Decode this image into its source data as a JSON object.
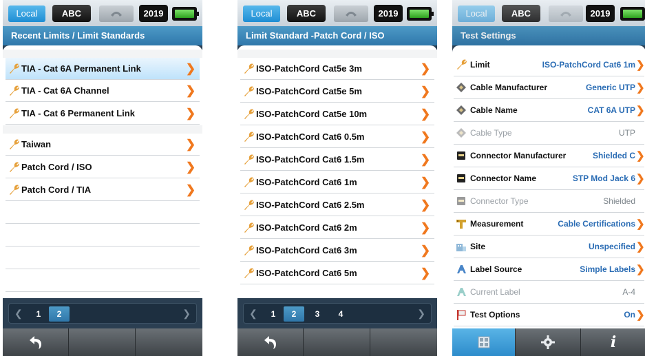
{
  "status": {
    "local_label": "Local",
    "abc_label": "ABC",
    "year_label": "2019"
  },
  "screen1": {
    "title": "Recent Limits / Limit Standards",
    "items": [
      {
        "label": "TIA - Cat 6A Permanent Link"
      },
      {
        "label": "TIA - Cat 6A Channel"
      },
      {
        "label": "TIA - Cat 6 Permanent Link"
      },
      {
        "label": "Taiwan"
      },
      {
        "label": "Patch Cord / ISO"
      },
      {
        "label": "Patch Cord / TIA"
      }
    ],
    "pages": [
      "1",
      "2"
    ],
    "active_page": "2"
  },
  "screen2": {
    "title": "Limit Standard -Patch Cord / ISO",
    "items": [
      {
        "label": "ISO-PatchCord Cat5e 3m"
      },
      {
        "label": "ISO-PatchCord Cat5e 5m"
      },
      {
        "label": "ISO-PatchCord Cat5e 10m"
      },
      {
        "label": "ISO-PatchCord Cat6 0.5m"
      },
      {
        "label": "ISO-PatchCord Cat6 1.5m"
      },
      {
        "label": "ISO-PatchCord Cat6 1m"
      },
      {
        "label": "ISO-PatchCord Cat6 2.5m"
      },
      {
        "label": "ISO-PatchCord Cat6 2m"
      },
      {
        "label": "ISO-PatchCord Cat6 3m"
      },
      {
        "label": "ISO-PatchCord Cat6 5m"
      }
    ],
    "pages": [
      "1",
      "2",
      "3",
      "4"
    ],
    "active_page": "2"
  },
  "screen3": {
    "title": "Test Settings",
    "settings": [
      {
        "name": "Limit",
        "value": "ISO-PatchCord Cat6 1m",
        "icon": "wrench-icon",
        "enabled": true
      },
      {
        "name": "Cable Manufacturer",
        "value": "Generic UTP",
        "icon": "cable-icon",
        "enabled": true
      },
      {
        "name": "Cable Name",
        "value": "CAT 6A UTP",
        "icon": "cable-icon",
        "enabled": true
      },
      {
        "name": "Cable Type",
        "value": "UTP",
        "icon": "cable-icon",
        "enabled": false
      },
      {
        "name": "Connector Manufacturer",
        "value": "Shielded C",
        "icon": "connector-icon",
        "enabled": true
      },
      {
        "name": "Connector Name",
        "value": "STP Mod Jack 6",
        "icon": "connector-icon",
        "enabled": true
      },
      {
        "name": "Connector Type",
        "value": "Shielded",
        "icon": "connector-icon",
        "enabled": false
      },
      {
        "name": "Measurement",
        "value": "Cable Certifications",
        "icon": "measurement-icon",
        "enabled": true
      },
      {
        "name": "Site",
        "value": "Unspecified",
        "icon": "site-icon",
        "enabled": true
      },
      {
        "name": "Label Source",
        "value": "Simple Labels",
        "icon": "label-icon",
        "enabled": true
      },
      {
        "name": "Current Label",
        "value": "A-4",
        "icon": "label-icon",
        "enabled": false
      },
      {
        "name": "Test Options",
        "value": "On",
        "icon": "flag-icon",
        "enabled": true
      }
    ]
  },
  "colors": {
    "accent": "#2f77aa",
    "chevron": "#f0781e",
    "value_text": "#2a6cb4"
  }
}
